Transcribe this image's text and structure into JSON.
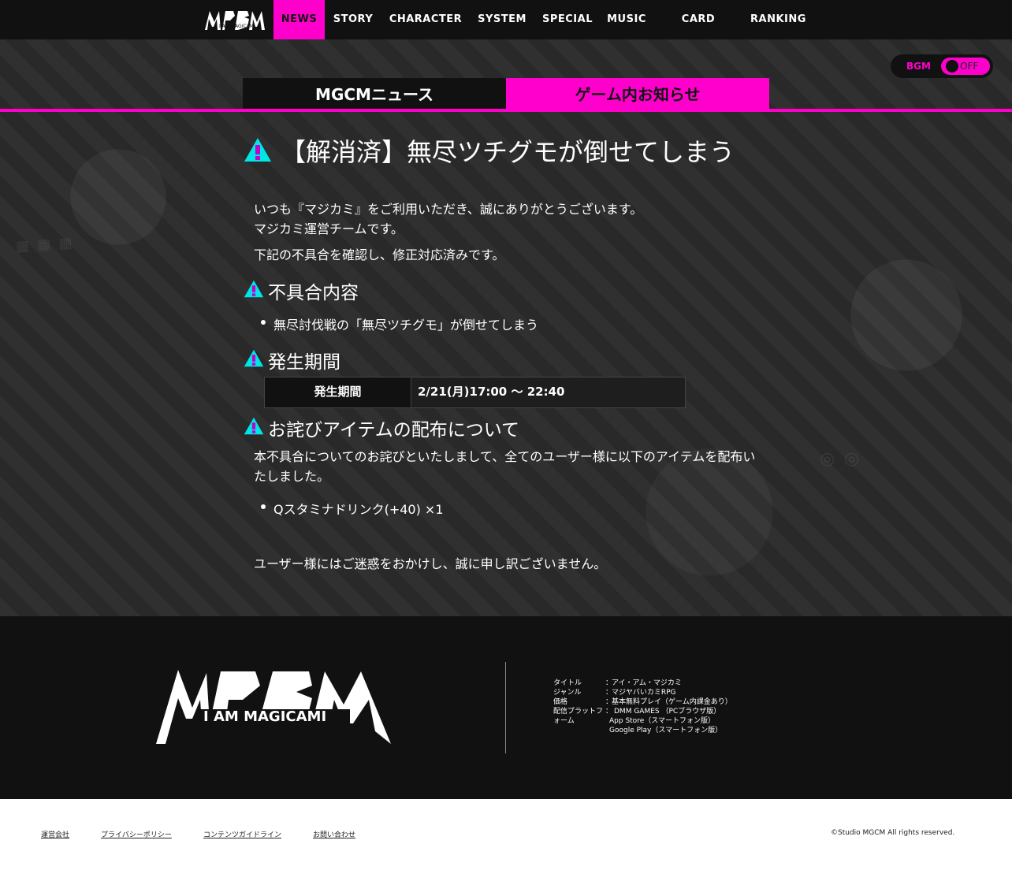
{
  "brand": {
    "logo_text_small": "I AM MAGICAMI",
    "logo_text_large": "I AM MAGICAMI"
  },
  "nav": {
    "items": [
      {
        "label": "NEWS",
        "active": true
      },
      {
        "label": "STORY",
        "active": false
      },
      {
        "label": "CHARACTER",
        "active": false
      },
      {
        "label": "SYSTEM",
        "active": false
      },
      {
        "label": "SPECIAL",
        "active": false
      },
      {
        "label": "MUSIC",
        "active": false
      },
      {
        "label": "CARD MAKER",
        "active": false
      },
      {
        "label": "RANKING",
        "active": false
      }
    ]
  },
  "bgm": {
    "label": "BGM",
    "state": "OFF"
  },
  "tabs": {
    "news": "MGCMニュース",
    "ingame": "ゲーム内お知らせ"
  },
  "article": {
    "title": "【解消済】無尽ツチグモが倒せてしまう",
    "intro_line1": "いつも『マジカミ』をご利用いただき、誠にありがとうございます。",
    "intro_line2": "マジカミ運営チームです。",
    "intro_line3": "下記の不具合を確認し、修正対応済みです。",
    "section1_heading": "不具合内容",
    "section1_item": "無尽討伐戦の「無尽ツチグモ」が倒せてしまう",
    "section2_heading": "発生期間",
    "period_label": "発生期間",
    "period_value": "2/21(月)17:00 ～ 22:40",
    "section3_heading": "お詫びアイテムの配布について",
    "section3_line1": "本不具合についてのお詫びといたしまして、全てのユーザー様に以下のアイテムを配布い",
    "section3_line2": "たしました。",
    "section3_item": "Qスタミナドリンク(+40) ×1",
    "closing": "ユーザー様にはご迷惑をおかけし、誠に申し訳ございません。"
  },
  "footer": {
    "info": [
      {
        "key": "タイトル",
        "sep": "：",
        "value": "アイ・アム・マジカミ"
      },
      {
        "key": "ジャンル",
        "sep": "：",
        "value": "マジヤバいカミRPG"
      },
      {
        "key": "価格",
        "sep": "：",
        "value": "基本無料プレイ（ゲーム内課金あり）"
      },
      {
        "key": "配信プラットフ",
        "sep": "：",
        "value": "DMM GAMES （PCブラウザ版）"
      },
      {
        "key": "ォーム",
        "sep": "",
        "value": "App Store（スマートフォン版）"
      },
      {
        "key": "",
        "sep": "",
        "value": "Google Play（スマートフォン版）"
      }
    ],
    "links": [
      "運営会社",
      "プライバシーポリシー",
      "コンテンツガイドライン",
      "お問い合わせ"
    ],
    "copyright": "©Studio MGCM All rights reserved."
  },
  "colors": {
    "accent": "#ff00cc",
    "dark": "#111111",
    "icon_cyan": "#00e5e5"
  }
}
